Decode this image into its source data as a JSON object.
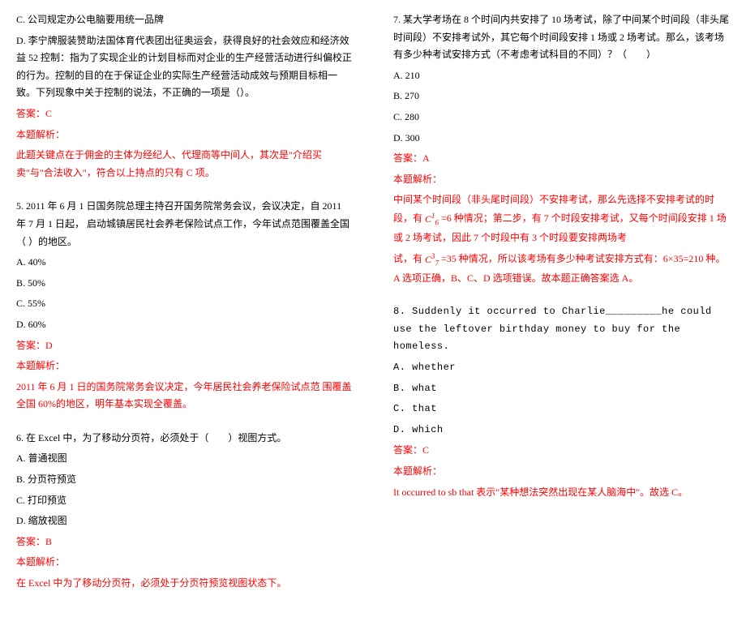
{
  "left": {
    "q4_optC": "C. 公司规定办公电脑要用统一品牌",
    "q4_optD": "D. 李宁牌服装赞助法国体育代表团出征奥运会，获得良好的社会效应和经济效益 52 控制：指为了实现企业的计划目标而对企业的生产经营活动进行纠偏校正的行为。控制的目的在于保证企业的实际生产经营活动成效与预期目标相一致。下列现象中关于控制的说法，不正确的一项是（）。",
    "q4_answer_label": "答案：C",
    "q4_analysis_label": "本题解析：",
    "q4_analysis": "此题关键点在于佣金的主体为经纪人、代理商等中间人，其次是\"介绍买卖\"与\"合法收入\"，符合以上持点的只有 C 项。",
    "q5_stem": "5. 2011 年 6 月 1 日国务院总理主持召开国务院常务会议，会议决定，自 2011 年 7 月 1 日起，  启动城镇居民社会养老保险试点工作，今年试点范围覆盖全国（  ）的地区。",
    "q5_optA": "A. 40%",
    "q5_optB": "B. 50%",
    "q5_optC": "C. 55%",
    "q5_optD": "D. 60%",
    "q5_answer_label": "答案：D",
    "q5_analysis_label": "本题解析：",
    "q5_analysis": "2011 年 6 月 1 日的国务院常务会议决定，今年居民社会养老保险试点范 围覆盖全国 60%的地区，明年基本实现全覆盖。",
    "q6_stem": "6. 在 Excel 中，为了移动分页符，必须处于（　　）视图方式。",
    "q6_optA": "A. 普通视图",
    "q6_optB": "B. 分页符预览",
    "q6_optC": "C. 打印预览",
    "q6_optD": "D. 缩放视图",
    "q6_answer_label": "答案：B",
    "q6_analysis_label": "本题解析：",
    "q6_analysis": "在 Excel 中为了移动分页符，必须处于分页符预览视图状态下。"
  },
  "right": {
    "q7_stem": "7. 某大学考场在 8 个时间内共安排了 10 场考试，除了中间某个时间段（非头尾时间段）不安排考试外，其它每个时间段安排 1 场或 2 场考试。那么，该考场有多少种考试安排方式（不考虑考试科目的不同）？（　　）",
    "q7_optA": "A. 210",
    "q7_optB": "B. 270",
    "q7_optC": "C. 280",
    "q7_optD": "D. 300",
    "q7_answer_label": "答案：A",
    "q7_analysis_label": "本题解析：",
    "q7_analysis_p1a": "中间某个时间段（非头尾时间段）不安排考试，那么先选择不安排考试的时段，有 ",
    "q7_analysis_p1b": " =6 种情况；第二步，有 7 个时段安排考试，又每个时间段安排 1 场或 2 场考试，因此 7 个时段中有 3 个时段要安排两场考",
    "q7_analysis_p2a": "试，有 ",
    "q7_analysis_p2b": " =35 种情况，所以该考场有多少种考试安排方式有：6×35=210 种。A 选项正确，B、C、D 选项错误。故本题正确答案选 A。",
    "q8_stem": "8. Suddenly it occurred to Charlie_________he could use the leftover birthday money to buy for the homeless.",
    "q8_optA": "A. whether",
    "q8_optB": "B. what",
    "q8_optC": "C. that",
    "q8_optD": "D. which",
    "q8_answer_label": "答案：C",
    "q8_analysis_label": "本题解析：",
    "q8_analysis": "It occurred to sb that 表示\"某种想法突然出现在某人脑海中\"。故选 C。"
  },
  "math": {
    "c61": "C",
    "c61_sup": "1",
    "c61_sub": "6",
    "c73": "C",
    "c73_sup": "3",
    "c73_sub": "7"
  }
}
